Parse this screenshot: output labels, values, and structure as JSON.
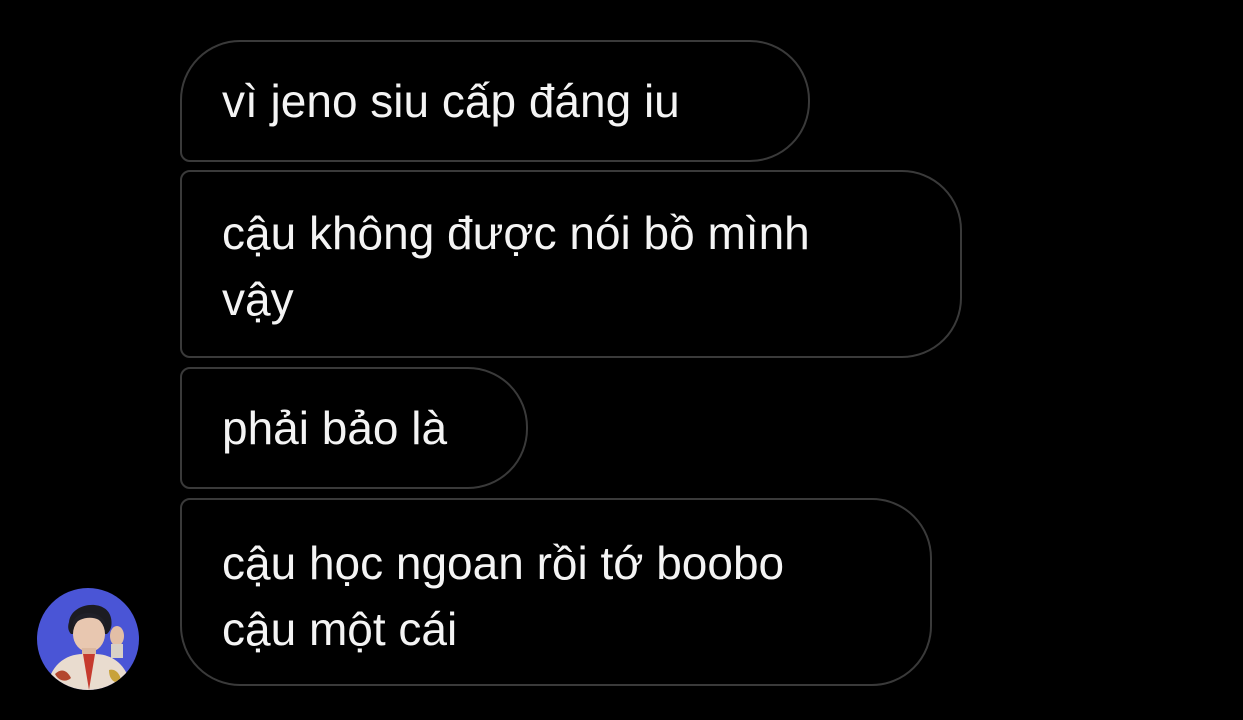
{
  "conversation": {
    "messages": [
      {
        "lines": [
          "vì jeno siu cấp đáng iu"
        ]
      },
      {
        "lines": [
          "cậu không được nói bồ mình",
          "vậy"
        ]
      },
      {
        "lines": [
          "phải bảo là"
        ]
      },
      {
        "lines": [
          "cậu học ngoan rồi tớ boobo",
          "cậu một cái"
        ]
      }
    ]
  },
  "colors": {
    "background": "#000000",
    "bubble_border": "#3a3a3a",
    "text": "#f4f4f4",
    "avatar_background": "#4a55d6"
  }
}
